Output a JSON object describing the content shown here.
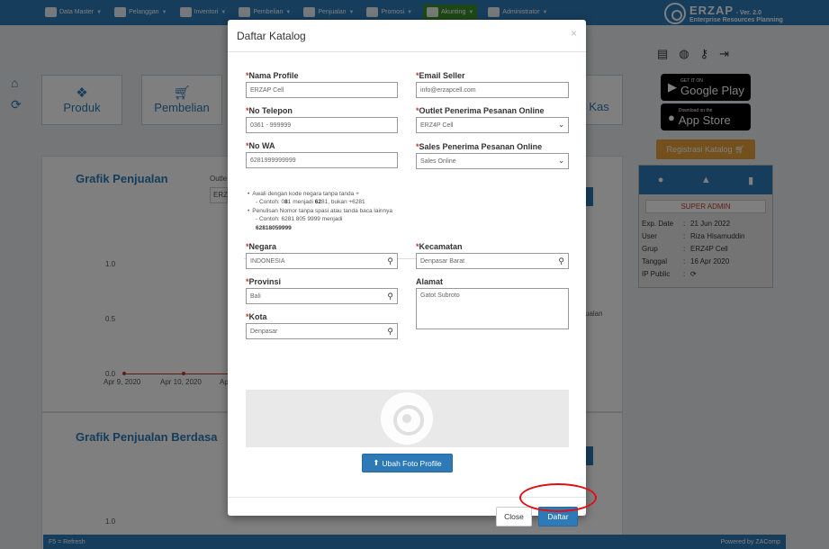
{
  "topbar": {
    "nav": [
      {
        "label": "Data Master",
        "icon": "list-icon"
      },
      {
        "label": "Pelanggan",
        "icon": "users-icon"
      },
      {
        "label": "Inventori",
        "icon": "briefcase-icon"
      },
      {
        "label": "Pembelian",
        "icon": "cart-icon"
      },
      {
        "label": "Penjualan",
        "icon": "document-icon"
      },
      {
        "label": "Promosi",
        "icon": "percent-icon"
      },
      {
        "label": "Akunting",
        "icon": "money-icon"
      },
      {
        "label": "Administrator",
        "icon": "gear-icon"
      }
    ],
    "brand_name": "ERZAP",
    "brand_version": "- Ver. 2.0",
    "brand_sub": "Enterprise Resources Planning"
  },
  "background": {
    "tiles": {
      "produk": "Produk",
      "pembelian": "Pembelian",
      "kas": "Kas"
    },
    "chart1": {
      "title": "Grafik Penjualan",
      "outlet_label": "Outle",
      "outlet_value": "ERZ",
      "y_ticks": [
        "1.0",
        "0.5",
        "0.0"
      ],
      "x_ticks": [
        "Apr 9, 2020",
        "Apr 10, 2020",
        "Apr"
      ],
      "legend_fragment": "ualan"
    },
    "chart2": {
      "title": "Grafik Penjualan Berdasa",
      "y_tick": "1.0"
    },
    "stores": {
      "google_small": "GET IT ON",
      "google_big": "Google Play",
      "apple_small": "Download on the",
      "apple_big": "App Store"
    },
    "register_button": "Registrasi Katalog",
    "user_card": {
      "role": "SUPER ADMIN",
      "rows": [
        {
          "k": "Exp. Date",
          "v": "21 Jun 2022"
        },
        {
          "k": "User",
          "v": "Riza Hisamuddin"
        },
        {
          "k": "Grup",
          "v": "ERZ4P Cell"
        },
        {
          "k": "Tanggal",
          "v": "16 Apr 2020"
        },
        {
          "k": "IP Public",
          "v": ""
        }
      ]
    },
    "footer_left": "F5 = Refresh",
    "footer_right": "Powered by ZAComp"
  },
  "modal": {
    "title": "Daftar Katalog",
    "close": "×",
    "fields": {
      "nama_profile": {
        "label": "Nama Profile",
        "value": "ERZAP Cell"
      },
      "email_seller": {
        "label": "Email Seller",
        "value": "info@erzapcell.com"
      },
      "no_telepon": {
        "label": "No Telepon",
        "value": "0361 - 999999"
      },
      "outlet": {
        "label": "Outlet Penerima Pesanan Online",
        "value": "ERZ4P Cell"
      },
      "no_wa": {
        "label": "No WA",
        "value": "6281999999999"
      },
      "sales": {
        "label": "Sales Penerima Pesanan Online",
        "value": "Sales Online"
      },
      "negara": {
        "label": "Negara",
        "value": "INDONESIA"
      },
      "kecamatan": {
        "label": "Kecamatan",
        "value": "Denpasar Barat"
      },
      "provinsi": {
        "label": "Provinsi",
        "value": "Bali"
      },
      "alamat": {
        "label": "Alamat",
        "value": "Gatot Subroto"
      },
      "kota": {
        "label": "Kota",
        "value": "Denpasar"
      }
    },
    "hints": {
      "h1": "Awali dengan kode negara tanpa tanda +",
      "h1_ex_a": "- Contoh: 0",
      "h1_ex_b": "8",
      "h1_ex_c": "1 menjadi ",
      "h1_ex_d": "62",
      "h1_ex_e": "81, bukan +6281",
      "h2": "Penulisan Nomor tanpa spasi atau tanda baca lainnya",
      "h2_ex": "- Contoh: 6281 805 9999 menjadi",
      "h2_ex_bold": "62818059999"
    },
    "upload_button": "Ubah Foto Profile",
    "close_button": "Close",
    "submit_button": "Daftar"
  }
}
